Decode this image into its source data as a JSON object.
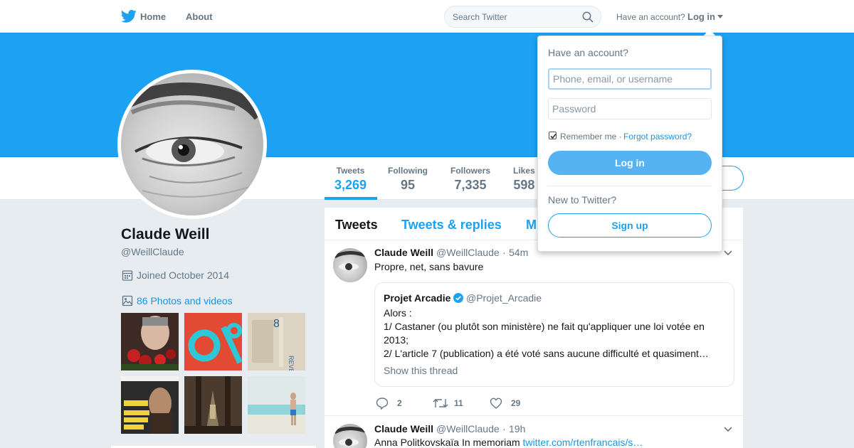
{
  "colors": {
    "brand": "#1da1f2",
    "link": "#1b95e0",
    "text": "#14171a",
    "muted": "#657786",
    "background": "#e6ecf0"
  },
  "nav": {
    "logo_icon": "twitter-bird-icon",
    "home": "Home",
    "about": "About",
    "search_placeholder": "Search Twitter",
    "have_account": "Have an account?",
    "login": "Log in"
  },
  "profile": {
    "name": "Claude Weill",
    "handle": "@WeillClaude",
    "joined": "Joined October 2014",
    "photos_videos": "86 Photos and videos",
    "stats": [
      {
        "label": "Tweets",
        "value": "3,269"
      },
      {
        "label": "Following",
        "value": "95"
      },
      {
        "label": "Followers",
        "value": "7,335"
      },
      {
        "label": "Likes",
        "value": "598"
      }
    ]
  },
  "timeline": {
    "tabs": [
      "Tweets",
      "Tweets & replies",
      "M"
    ],
    "tweets": [
      {
        "name": "Claude Weill",
        "handle": "@WeillClaude",
        "time": "54m",
        "text": "Propre, net, sans bavure",
        "quote": {
          "name": "Projet Arcadie",
          "handle": "@Projet_Arcadie",
          "lines": [
            "Alors :",
            "1/ Castaner (ou plutôt son ministère) ne fait qu'appliquer une loi votée en",
            "2013;",
            "2/ L'article 7 (publication) a été voté sans aucune difficulté et quasiment…"
          ],
          "thread": "Show this thread"
        },
        "replies": "2",
        "retweets": "11",
        "likes": "29"
      },
      {
        "name": "Claude Weill",
        "handle": "@WeillClaude",
        "time": "19h",
        "text": "Anna Politkovskaïa In memoriam ",
        "link": "twitter.com/rtenfrancais/s…"
      }
    ]
  },
  "login_dropdown": {
    "title": "Have an account?",
    "username_placeholder": "Phone, email, or username",
    "password_placeholder": "Password",
    "remember_me": "Remember me",
    "separator": " · ",
    "forgot_password": "Forgot password?",
    "login_button": "Log in",
    "new_to_twitter": "New to Twitter?",
    "signup_button": "Sign up"
  }
}
